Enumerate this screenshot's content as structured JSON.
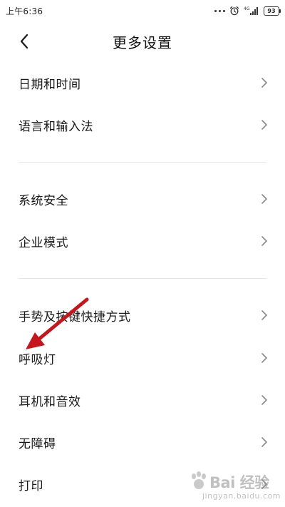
{
  "status_bar": {
    "time": "上午6:36",
    "icons": [
      "more-dots-icon",
      "alarm-clock-icon",
      "4g-signal-icon"
    ],
    "network": "4G",
    "battery": "93"
  },
  "header": {
    "title": "更多设置",
    "back_icon": "chevron-left-icon"
  },
  "menu": {
    "items": [
      {
        "label": "日期和时间"
      },
      {
        "label": "语言和输入法"
      },
      {
        "label": "系统安全"
      },
      {
        "label": "企业模式"
      },
      {
        "label": "手势及按键快捷方式"
      },
      {
        "label": "呼吸灯"
      },
      {
        "label": "耳机和音效"
      },
      {
        "label": "无障碍"
      },
      {
        "label": "打印"
      }
    ]
  },
  "annotation": {
    "color": "#c4161c",
    "points_to": "呼吸灯"
  },
  "watermark": {
    "main": "Bai 经验",
    "sub": "jingyan.baidu.com"
  }
}
